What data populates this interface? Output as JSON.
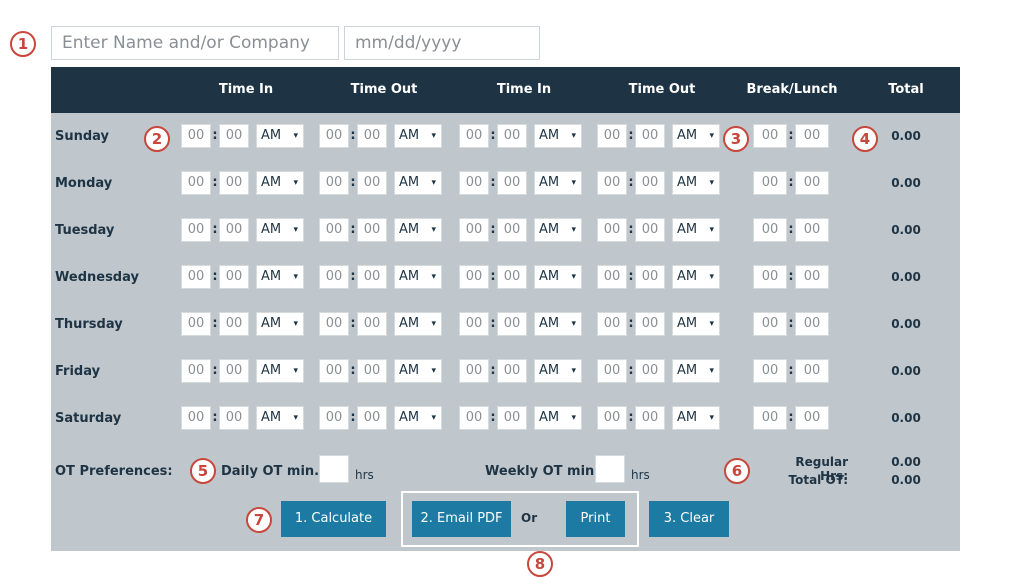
{
  "markers": [
    "1",
    "2",
    "3",
    "4",
    "5",
    "6",
    "7",
    "8"
  ],
  "top": {
    "name_placeholder": "Enter Name and/or Company",
    "date_placeholder": "mm/dd/yyyy"
  },
  "header": {
    "time_in_1": "Time In",
    "time_out_1": "Time Out",
    "time_in_2": "Time In",
    "time_out_2": "Time Out",
    "break_lunch": "Break/Lunch",
    "total": "Total"
  },
  "days": [
    {
      "label": "Sunday",
      "total": "0.00"
    },
    {
      "label": "Monday",
      "total": "0.00"
    },
    {
      "label": "Tuesday",
      "total": "0.00"
    },
    {
      "label": "Wednesday",
      "total": "0.00"
    },
    {
      "label": "Thursday",
      "total": "0.00"
    },
    {
      "label": "Friday",
      "total": "0.00"
    },
    {
      "label": "Saturday",
      "total": "0.00"
    }
  ],
  "time_default": {
    "hh": "00",
    "sep": ":",
    "mm": "00",
    "ampm": "AM",
    "caret": "▾"
  },
  "ot": {
    "label": "OT Preferences:",
    "daily_label": "Daily OT min.",
    "weekly_label": "Weekly OT min.",
    "hrs": "hrs",
    "regular_label": "Regular Hrs:",
    "regular_value": "0.00",
    "total_ot_label": "Total OT:",
    "total_ot_value": "0.00"
  },
  "buttons": {
    "calculate": "1. Calculate",
    "email_pdf": "2. Email PDF",
    "or": "Or",
    "print": "Print",
    "clear": "3. Clear"
  },
  "colors": {
    "header": "#1e3444",
    "panel": "#bfc6cc",
    "button": "#1c7aa3",
    "marker": "#c8473c"
  }
}
